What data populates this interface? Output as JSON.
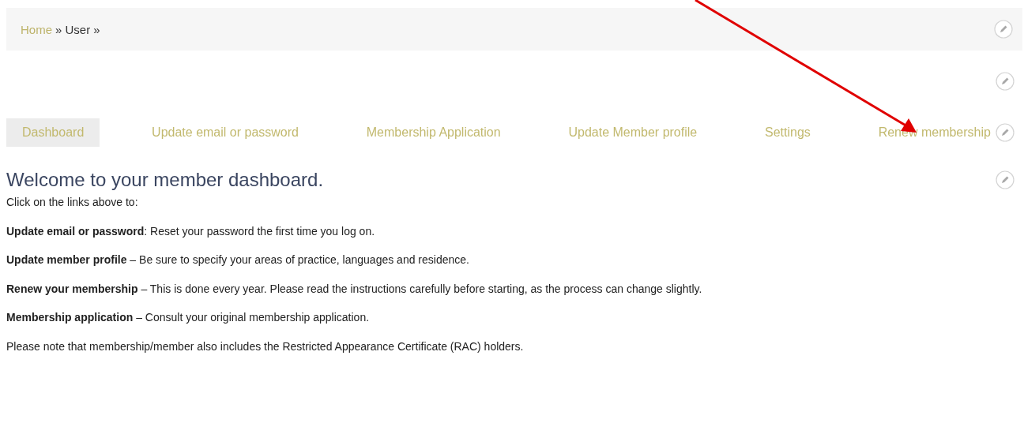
{
  "breadcrumb": {
    "links": [
      "Home"
    ],
    "current": "» User »"
  },
  "tabs": [
    {
      "label": "Dashboard",
      "selected": true
    },
    {
      "label": "Update email or password",
      "selected": false
    },
    {
      "label": "Membership Application",
      "selected": false
    },
    {
      "label": "Update Member profile",
      "selected": false
    },
    {
      "label": "Settings",
      "selected": false
    },
    {
      "label": "Renew membership",
      "selected": false
    }
  ],
  "heading": "Welcome to your member dashboard.",
  "paragraphs": [
    "Click on the links above to:",
    "**Update email or password**: Reset your password the first time you log on.",
    "**Update member profile** – Be sure to specify your areas of practice, languages and residence.",
    "**Renew your membership** – This is done every year. Please read the instructions carefully before starting, as the process can change slightly.",
    "**Membership application** – Consult your original membership application.",
    "Please note that membership/member also includes the Restricted Appearance Certificate (RAC) holders."
  ]
}
